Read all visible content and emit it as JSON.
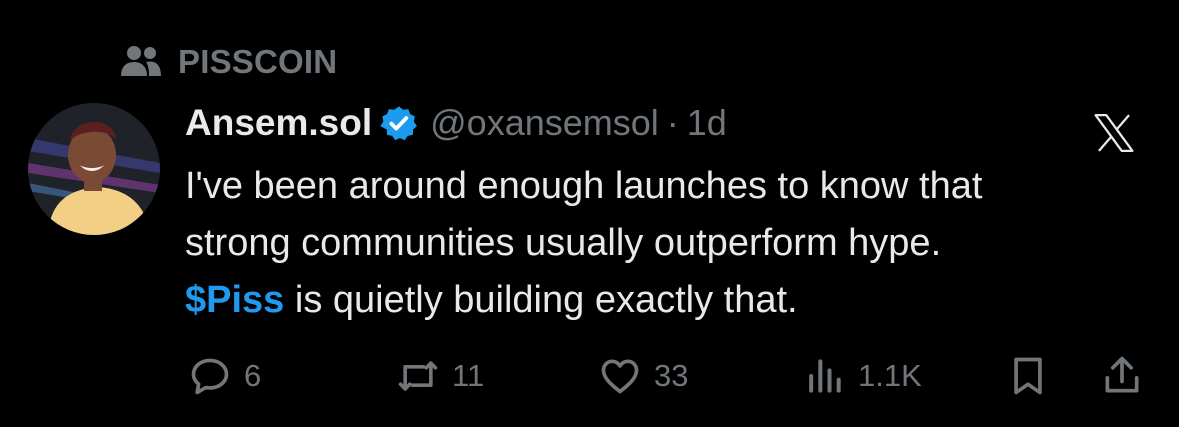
{
  "community": {
    "name": "PISSCOIN",
    "icon": "community-icon"
  },
  "author": {
    "display_name": "Ansem.sol",
    "verified": true,
    "handle": "@oxansemsol",
    "separator": "·",
    "time": "1d"
  },
  "tweet": {
    "lines": [
      "I've been around enough launches to know that",
      "strong communities usually outperform hype."
    ],
    "cashtag": "$Piss",
    "last_line_rest": " is quietly building exactly that."
  },
  "actions": {
    "replies": "6",
    "reposts": "11",
    "likes": "33",
    "views": "1.1K"
  },
  "colors": {
    "background": "#000000",
    "text": "#e7e9ea",
    "muted": "#71767b",
    "accent": "#1d9bf0"
  },
  "icons": [
    "community-icon",
    "verified-badge-icon",
    "x-logo-icon",
    "reply-icon",
    "repost-icon",
    "like-icon",
    "views-icon",
    "bookmark-icon",
    "share-icon"
  ]
}
